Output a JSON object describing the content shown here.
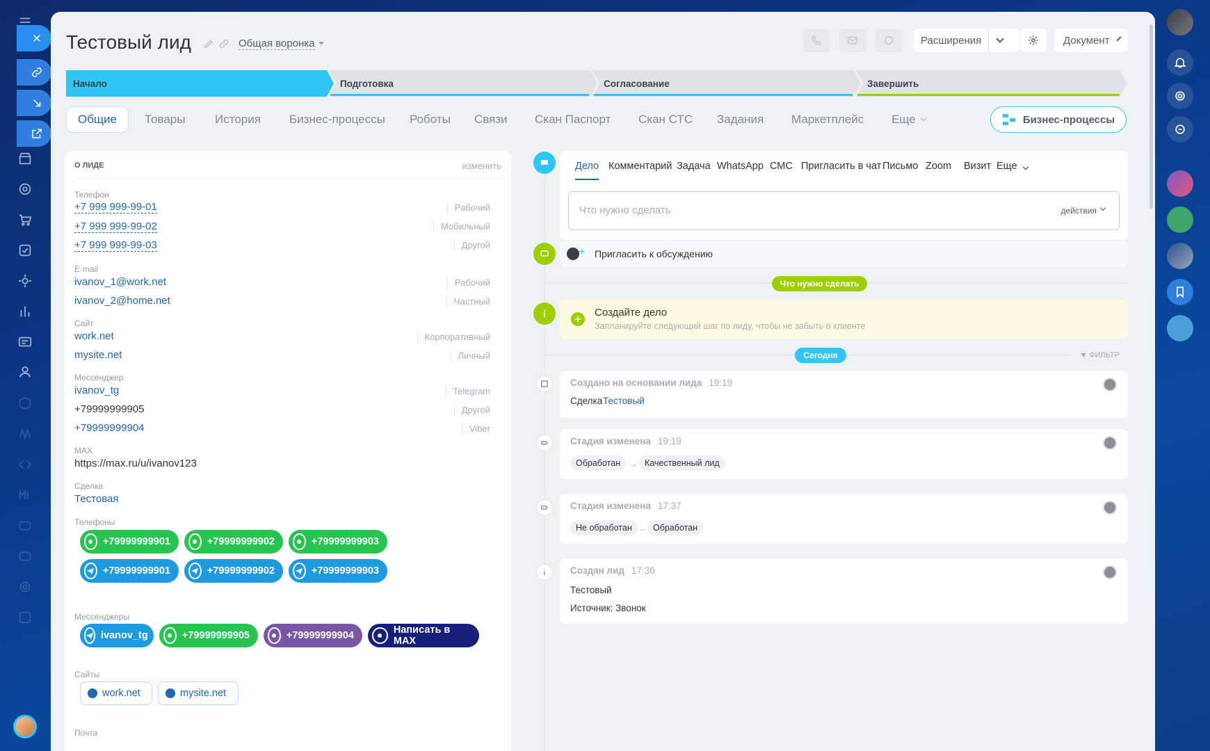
{
  "lead": {
    "title": "Тестовый лид",
    "funnel": "Общая воронка"
  },
  "header": {
    "extensions": "Расширения",
    "document": "Документ"
  },
  "stages": [
    "Начало",
    "Подготовка",
    "Согласование",
    "Завершить"
  ],
  "tabs": {
    "general": "Общие",
    "goods": "Товары",
    "history": "История",
    "bp": "Бизнес-процессы",
    "robots": "Роботы",
    "links": "Связи",
    "scan_passport": "Скан Паспорт",
    "scan_sts": "Скан СТС",
    "tasks": "Задания",
    "marketplace": "Маркетплейс",
    "more": "Еще",
    "bp_button": "Бизнес-процессы"
  },
  "about": {
    "header": "о лиде",
    "edit": "изменить",
    "phone_label": "Телефон",
    "phones": [
      {
        "value": "+7 999 999-99-01",
        "type": "Рабочий"
      },
      {
        "value": "+7 999 999-99-02",
        "type": "Мобильный"
      },
      {
        "value": "+7 999 999-99-03",
        "type": "Другой"
      }
    ],
    "email_label": "E-mail",
    "emails": [
      {
        "value": "ivanov_1@work.net",
        "type": "Рабочий"
      },
      {
        "value": "ivanov_2@home.net",
        "type": "Частный"
      }
    ],
    "site_label": "Сайт",
    "sites": [
      {
        "value": "work.net",
        "type": "Корпоративный"
      },
      {
        "value": "mysite.net",
        "type": "Личный"
      }
    ],
    "messenger_label": "Мессенджер",
    "messengers": [
      {
        "value": "ivanov_tg",
        "type": "Telegram"
      },
      {
        "value": "+79999999905",
        "type": "Другой"
      },
      {
        "value": "+79999999904",
        "type": "Viber"
      }
    ],
    "max_label": "MAX",
    "max_value": "https://max.ru/u/ivanov123",
    "deal_label": "Сделка",
    "deal_value": "Тестовая",
    "phones_label": "Телефоны",
    "wa": [
      "+79999999901",
      "+79999999902",
      "+79999999903"
    ],
    "tg": [
      "+79999999901",
      "+79999999902",
      "+79999999903"
    ],
    "messengers_label": "Мессенджеры",
    "m_tg": "ivanov_tg",
    "m_wa": "+79999999905",
    "m_viber": "+79999999904",
    "m_max": "Написать в MAX",
    "sites_label": "Сайты",
    "site_chips": [
      "work.net",
      "mysite.net"
    ],
    "mail_label": "Почта"
  },
  "editor": {
    "tabs": [
      "Дело",
      "Комментарий",
      "Задача",
      "WhatsApp",
      "СМС",
      "Пригласить в чат",
      "Письмо",
      "Zoom",
      "Визит",
      "Еще"
    ],
    "placeholder": "Что нужно сделать",
    "actions": "действия"
  },
  "invite": "Пригласить к обсуждению",
  "todo_badge": "Что нужно сделать",
  "create_task": {
    "title": "Создайте дело",
    "hint": "Запланируйте следующий шаг по лиду, чтобы не забыть о клиенте"
  },
  "today_badge": "Сегодня",
  "filter": "фильтр",
  "events": {
    "e1": {
      "title": "Создано на основании лида",
      "time": "19:19",
      "prefix": "Сделка",
      "link": "Тестовый"
    },
    "e2": {
      "title": "Стадия изменена",
      "time": "19:19",
      "from": "Обработан",
      "to": "Качественный лид"
    },
    "e3": {
      "title": "Стадия изменена",
      "time": "17:37",
      "from": "Не обработан",
      "to": "Обработан"
    },
    "e4": {
      "title": "Создан лид",
      "time": "17:36",
      "line1": "Тестовый",
      "line2": "Источник: Звонок"
    }
  },
  "colors": {
    "accent": "#2fc6f6",
    "stage_done": "#2fc6f6",
    "stage_todo": "#dfe3e6",
    "whatsapp": "#27c44f",
    "telegram": "#1e9be0",
    "viber": "#7a56a6",
    "max": "#16207a",
    "todo_badge": "#9dcf00",
    "info_bg": "#fffbe3"
  }
}
